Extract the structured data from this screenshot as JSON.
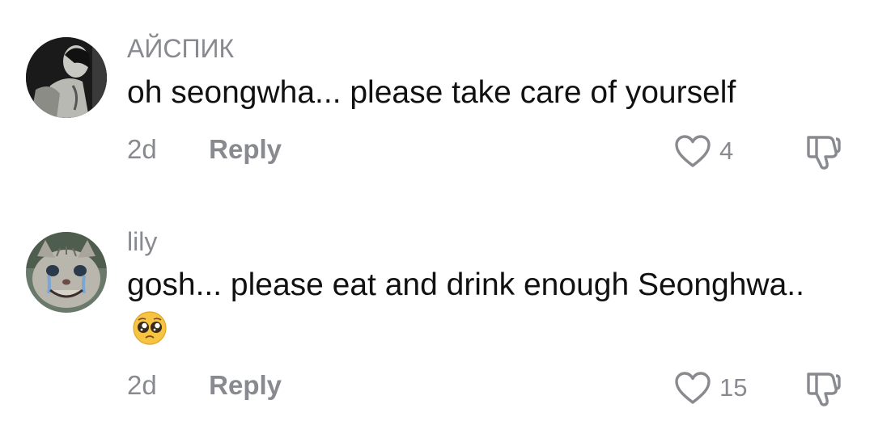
{
  "comments": [
    {
      "username": "АЙСПИК",
      "text": "oh seongwha... please take care of yourself",
      "time": "2d",
      "reply_label": "Reply",
      "like_count": "4",
      "avatar": "dark-figure-avatar"
    },
    {
      "username": "lily",
      "text": "gosh... please eat and drink enough Seonghwa..",
      "emoji": "pleading-face-emoji",
      "time": "2d",
      "reply_label": "Reply",
      "like_count": "15",
      "avatar": "crying-cat-avatar"
    }
  ],
  "icons": {
    "like": "heart-outline-icon",
    "dislike": "thumbs-down-icon"
  },
  "colors": {
    "background": "#ffffff",
    "text": "#111111",
    "muted": "#888a8f"
  }
}
